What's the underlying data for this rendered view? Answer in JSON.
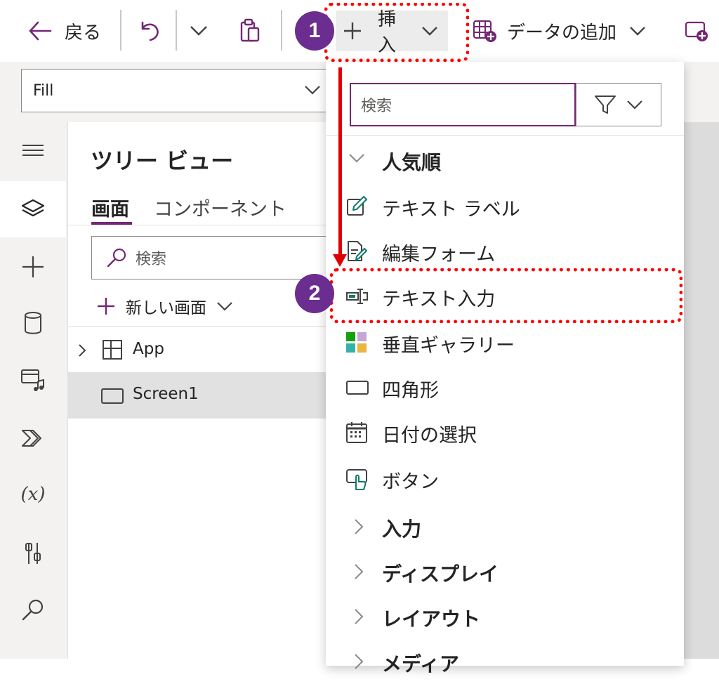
{
  "toolbar": {
    "back_label": "戻る",
    "insert_label": "挿入",
    "add_data_label": "データの追加"
  },
  "formula_bar": {
    "property_value": "Fill"
  },
  "tree_view": {
    "title": "ツリー ビュー",
    "tabs": [
      {
        "label": "画面",
        "active": true
      },
      {
        "label": "コンポーネント",
        "active": false
      }
    ],
    "search_placeholder": "検索",
    "new_screen_label": "新しい画面",
    "items": [
      {
        "label": "App"
      },
      {
        "label": "Screen1",
        "selected": true
      }
    ]
  },
  "insert_menu": {
    "search_placeholder": "検索",
    "popular_category": "人気順",
    "popular_items": [
      {
        "label": "テキスト ラベル",
        "icon": "text-label-icon"
      },
      {
        "label": "編集フォーム",
        "icon": "edit-form-icon"
      },
      {
        "label": "テキスト入力",
        "icon": "text-input-icon"
      },
      {
        "label": "垂直ギャラリー",
        "icon": "gallery-icon"
      },
      {
        "label": "四角形",
        "icon": "rectangle-icon"
      },
      {
        "label": "日付の選択",
        "icon": "calendar-icon"
      },
      {
        "label": "ボタン",
        "icon": "button-icon"
      }
    ],
    "categories": [
      {
        "label": "入力"
      },
      {
        "label": "ディスプレイ"
      },
      {
        "label": "レイアウト"
      },
      {
        "label": "メディア"
      }
    ]
  },
  "annotations": {
    "step1": "1",
    "step2": "2"
  },
  "colors": {
    "accent": "#742774",
    "annotation_red": "#ff0000",
    "badge_purple": "#6b2d8f",
    "teal": "#13a10e"
  }
}
